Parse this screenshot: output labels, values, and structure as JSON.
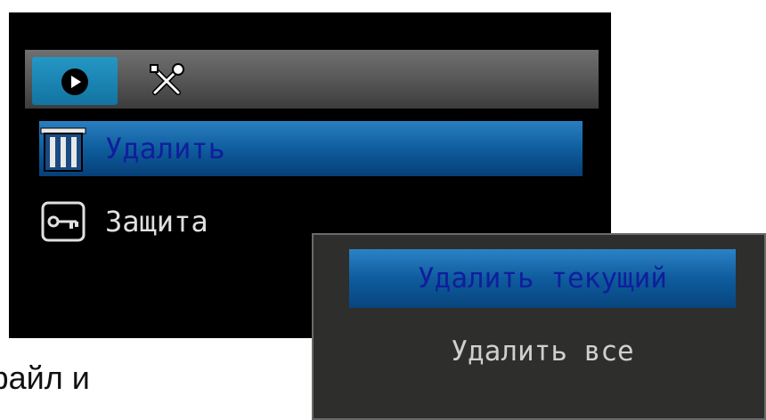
{
  "tabs": [
    {
      "id": "playback",
      "icon": "play-icon",
      "active": true
    },
    {
      "id": "settings",
      "icon": "tools-icon",
      "active": false
    }
  ],
  "menu": {
    "items": [
      {
        "label": "Удалить",
        "icon": "trash-icon",
        "selected": true
      },
      {
        "label": "Защита",
        "icon": "key-icon",
        "selected": false
      }
    ]
  },
  "popup": {
    "options": [
      {
        "label": "Удалить текущий",
        "selected": true
      },
      {
        "label": "Удалить все",
        "selected": false
      }
    ]
  },
  "caption": "файл и",
  "colors": {
    "screen_bg": "#000000",
    "highlight_blue": "#0f5e9e",
    "highlight_text": "#101e9c",
    "tab_active": "#1e86b4",
    "popup_bg": "#2e2e2c"
  }
}
